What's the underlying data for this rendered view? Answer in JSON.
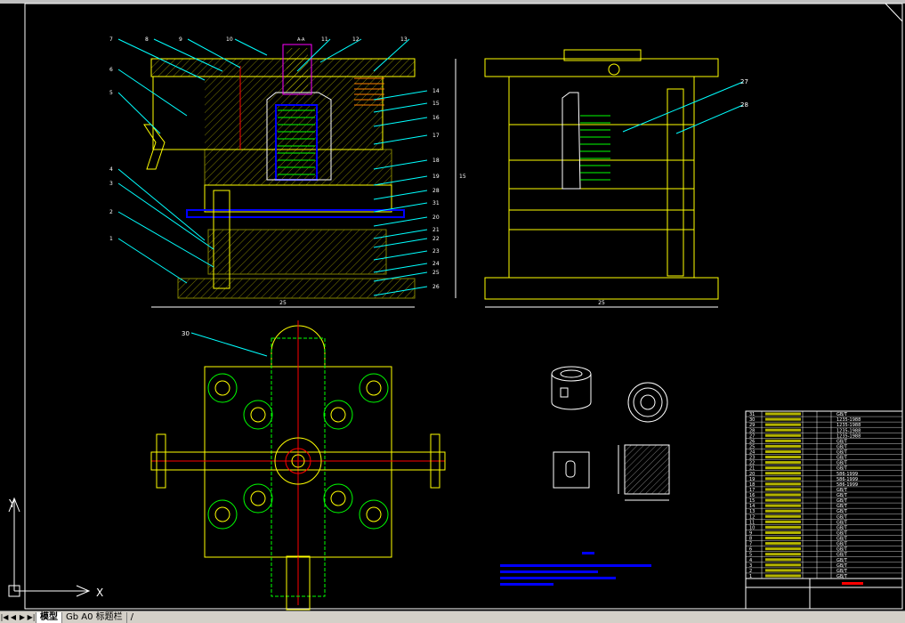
{
  "callouts_left": [
    "7",
    "8",
    "9",
    "10",
    "11",
    "12",
    "13",
    "6",
    "5",
    "4",
    "3",
    "2",
    "1"
  ],
  "callouts_right": [
    "14",
    "15",
    "16",
    "17",
    "18",
    "19",
    "20",
    "21",
    "22",
    "23",
    "24",
    "25",
    "26",
    "28",
    "31"
  ],
  "side_callouts": [
    "27",
    "28"
  ],
  "plan_callout": "30",
  "dimension_width": "25",
  "dimension_width_side": "25",
  "dimension_height": "15",
  "section_label_top": "A-A",
  "ucs": {
    "x_label": "X",
    "y_label": "Y"
  },
  "tabs": [
    "模型",
    "Gb A0 标题栏"
  ],
  "active_tab_index": 0,
  "bom_rows": [
    {
      "no": "31",
      "std": "GB/T"
    },
    {
      "no": "30",
      "std": "1235-1988"
    },
    {
      "no": "29",
      "std": "1235-1988"
    },
    {
      "no": "28",
      "std": "1235-1988"
    },
    {
      "no": "27",
      "std": "1235-1988"
    },
    {
      "no": "26",
      "std": "GB/T"
    },
    {
      "no": "25",
      "std": "GB/T"
    },
    {
      "no": "24",
      "std": "GB/T"
    },
    {
      "no": "23",
      "std": "GB/T"
    },
    {
      "no": "22",
      "std": "GB/T"
    },
    {
      "no": "21",
      "std": "GB/T"
    },
    {
      "no": "20",
      "std": "586-1999"
    },
    {
      "no": "19",
      "std": "586-1999"
    },
    {
      "no": "18",
      "std": "586-1999"
    },
    {
      "no": "17",
      "std": "GB/T"
    },
    {
      "no": "16",
      "std": "GB/T"
    },
    {
      "no": "15",
      "std": "GB/T"
    },
    {
      "no": "14",
      "std": "GB/T"
    },
    {
      "no": "13",
      "std": "GB/T"
    },
    {
      "no": "12",
      "std": "GB/T"
    },
    {
      "no": "11",
      "std": "GB/T"
    },
    {
      "no": "10",
      "std": "GB/T"
    },
    {
      "no": "9",
      "std": "GB/T"
    },
    {
      "no": "8",
      "std": "GB/T"
    },
    {
      "no": "7",
      "std": "GB/T"
    },
    {
      "no": "6",
      "std": "GB/T"
    },
    {
      "no": "5",
      "std": "GB/T"
    },
    {
      "no": "4",
      "std": "GB/T"
    },
    {
      "no": "3",
      "std": "GB/T"
    },
    {
      "no": "2",
      "std": "GB/T"
    },
    {
      "no": "1",
      "std": "GB/T"
    }
  ],
  "colors": {
    "yellow": "#ffff00",
    "cyan": "#00ffff",
    "green": "#00ff00",
    "blue": "#0000ff",
    "red": "#ff0000",
    "white": "#ffffff",
    "magenta": "#ff00ff",
    "orange": "#ff8000",
    "bg": "#000000"
  }
}
